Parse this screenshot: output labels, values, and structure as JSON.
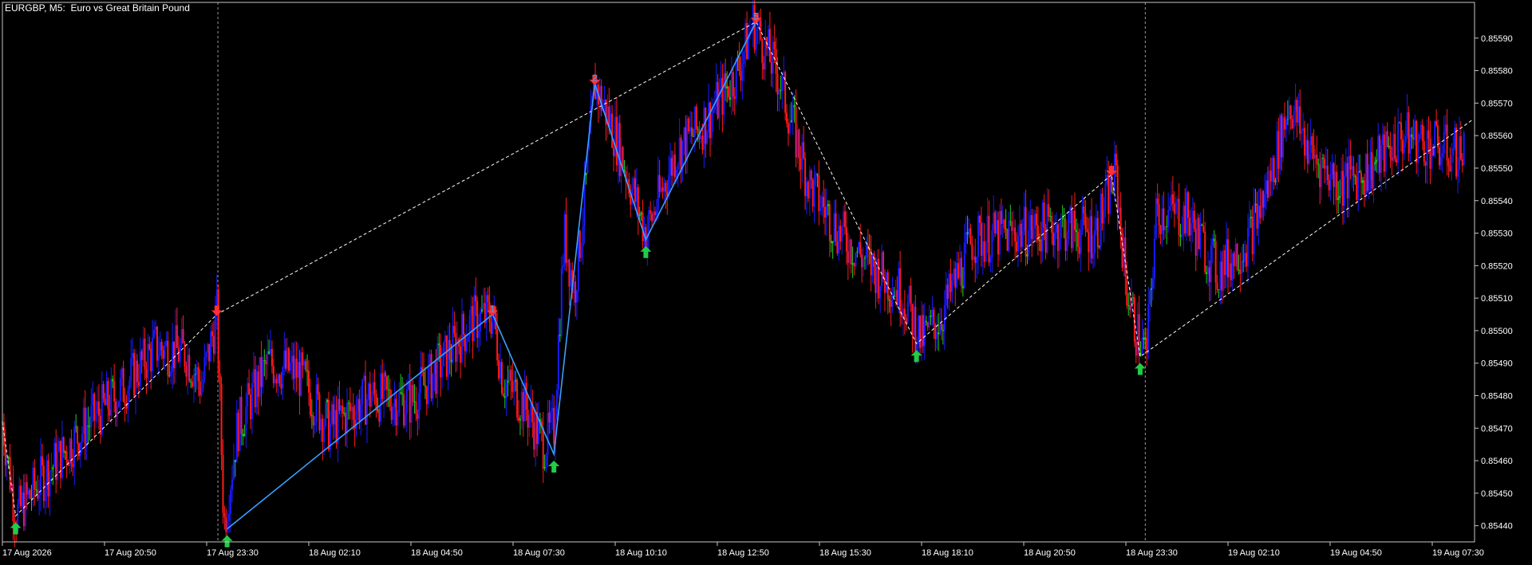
{
  "window": {
    "symbol_title": "EURGBP, M5:  Euro vs Great Britain Pound"
  },
  "colors": {
    "background": "#000000",
    "frame": "#c8c8c8",
    "text": "#ffffff",
    "bull_candle": "#1a1aff",
    "bear_candle": "#ff1a1a",
    "doji_candle": "#22cc22",
    "wave_line": "#3aa0ff",
    "dashed_zigzag": "#ffffff",
    "arrow_up": "#22cc44",
    "arrow_down": "#ff3030"
  },
  "chart_data": {
    "type": "candlestick",
    "symbol": "EURGBP",
    "timeframe": "M5",
    "ylim": [
      0.85436,
      0.856
    ],
    "price_ticks": [
      "0.85590",
      "0.85580",
      "0.85570",
      "0.85560",
      "0.85550",
      "0.85540",
      "0.85530",
      "0.85520",
      "0.85510",
      "0.85500",
      "0.85490",
      "0.85480",
      "0.85470",
      "0.85460",
      "0.85450",
      "0.85440"
    ],
    "time_ticks": [
      {
        "label": "17 Aug 2026",
        "x": 0
      },
      {
        "label": "17 Aug 20:50",
        "x": 10
      },
      {
        "label": "17 Aug 23:30",
        "x": 20
      },
      {
        "label": "18 Aug 02:10",
        "x": 30
      },
      {
        "label": "18 Aug 04:50",
        "x": 40
      },
      {
        "label": "18 Aug 07:30",
        "x": 50
      },
      {
        "label": "18 Aug 10:10",
        "x": 60
      },
      {
        "label": "18 Aug 12:50",
        "x": 70
      },
      {
        "label": "18 Aug 15:30",
        "x": 80
      },
      {
        "label": "18 Aug 18:10",
        "x": 90
      },
      {
        "label": "18 Aug 20:50",
        "x": 100
      },
      {
        "label": "18 Aug 23:30",
        "x": 110
      },
      {
        "label": "19 Aug 02:10",
        "x": 120
      },
      {
        "label": "19 Aug 04:50",
        "x": 130
      },
      {
        "label": "19 Aug 07:30",
        "x": 140
      }
    ],
    "x_range": [
      0,
      144
    ],
    "day_separators": [
      21.1,
      111.9
    ],
    "price_path": [
      {
        "x": 0,
        "p": 0.85472
      },
      {
        "x": 1.3,
        "p": 0.85443
      },
      {
        "x": 4,
        "p": 0.85455
      },
      {
        "x": 8,
        "p": 0.8547
      },
      {
        "x": 12,
        "p": 0.85483
      },
      {
        "x": 15,
        "p": 0.85495
      },
      {
        "x": 18,
        "p": 0.85493
      },
      {
        "x": 19.5,
        "p": 0.85483
      },
      {
        "x": 21,
        "p": 0.85505
      },
      {
        "x": 21.7,
        "p": 0.8544
      },
      {
        "x": 23,
        "p": 0.8547
      },
      {
        "x": 26,
        "p": 0.8549
      },
      {
        "x": 29,
        "p": 0.85487
      },
      {
        "x": 32,
        "p": 0.8547
      },
      {
        "x": 36,
        "p": 0.8548
      },
      {
        "x": 40,
        "p": 0.85478
      },
      {
        "x": 43,
        "p": 0.8549
      },
      {
        "x": 46,
        "p": 0.85503
      },
      {
        "x": 48,
        "p": 0.85505
      },
      {
        "x": 49,
        "p": 0.85485
      },
      {
        "x": 51,
        "p": 0.85478
      },
      {
        "x": 53,
        "p": 0.85465
      },
      {
        "x": 54,
        "p": 0.8547
      },
      {
        "x": 55,
        "p": 0.8553
      },
      {
        "x": 56,
        "p": 0.85512
      },
      {
        "x": 57,
        "p": 0.8554
      },
      {
        "x": 58,
        "p": 0.85576
      },
      {
        "x": 60,
        "p": 0.8556
      },
      {
        "x": 63,
        "p": 0.8553
      },
      {
        "x": 66,
        "p": 0.85555
      },
      {
        "x": 69,
        "p": 0.85565
      },
      {
        "x": 72,
        "p": 0.8558
      },
      {
        "x": 73.5,
        "p": 0.85595
      },
      {
        "x": 76,
        "p": 0.85578
      },
      {
        "x": 79,
        "p": 0.85545
      },
      {
        "x": 82,
        "p": 0.8553
      },
      {
        "x": 85,
        "p": 0.8552
      },
      {
        "x": 88,
        "p": 0.85512
      },
      {
        "x": 90,
        "p": 0.85497
      },
      {
        "x": 92,
        "p": 0.85505
      },
      {
        "x": 95,
        "p": 0.85528
      },
      {
        "x": 99,
        "p": 0.8553
      },
      {
        "x": 103,
        "p": 0.85532
      },
      {
        "x": 107,
        "p": 0.8553
      },
      {
        "x": 109,
        "p": 0.85548
      },
      {
        "x": 110,
        "p": 0.85515
      },
      {
        "x": 111,
        "p": 0.855
      },
      {
        "x": 112,
        "p": 0.85492
      },
      {
        "x": 113,
        "p": 0.85537
      },
      {
        "x": 116,
        "p": 0.85535
      },
      {
        "x": 119,
        "p": 0.85518
      },
      {
        "x": 122,
        "p": 0.85528
      },
      {
        "x": 124,
        "p": 0.85545
      },
      {
        "x": 126,
        "p": 0.8557
      },
      {
        "x": 128,
        "p": 0.85555
      },
      {
        "x": 131,
        "p": 0.85545
      },
      {
        "x": 134,
        "p": 0.8555
      },
      {
        "x": 137,
        "p": 0.8556
      },
      {
        "x": 140,
        "p": 0.85557
      },
      {
        "x": 142,
        "p": 0.85555
      }
    ],
    "wave_labels": [
      {
        "label": "1",
        "x": 48.0,
        "p": 0.85505
      },
      {
        "label": "2",
        "x": 58.0,
        "p": 0.85576
      },
      {
        "label": "5",
        "x": 73.8,
        "p": 0.85595
      }
    ],
    "wave_path": [
      {
        "x": 22.0,
        "p": 0.85439
      },
      {
        "x": 48.0,
        "p": 0.85505
      },
      {
        "x": 54.0,
        "p": 0.85462
      },
      {
        "x": 58.0,
        "p": 0.85576
      },
      {
        "x": 63.0,
        "p": 0.85528
      },
      {
        "x": 73.8,
        "p": 0.85595
      }
    ],
    "dashed_zigzag": [
      {
        "x": 0,
        "p": 0.85472
      },
      {
        "x": 1.3,
        "p": 0.85443
      },
      {
        "x": 21.0,
        "p": 0.85505
      },
      {
        "x": 73.8,
        "p": 0.85595
      },
      {
        "x": 89.5,
        "p": 0.85496
      },
      {
        "x": 108.6,
        "p": 0.85548
      },
      {
        "x": 111.4,
        "p": 0.85492
      },
      {
        "x": 144,
        "p": 0.85565
      }
    ],
    "arrows_up": [
      {
        "x": 1.3,
        "p": 0.85443
      },
      {
        "x": 22.0,
        "p": 0.85439
      },
      {
        "x": 54.0,
        "p": 0.85462
      },
      {
        "x": 63.0,
        "p": 0.85528
      },
      {
        "x": 89.5,
        "p": 0.85496
      },
      {
        "x": 111.4,
        "p": 0.85492
      }
    ],
    "arrows_down": [
      {
        "x": 21.0,
        "p": 0.85505
      },
      {
        "x": 48.0,
        "p": 0.85505
      },
      {
        "x": 58.0,
        "p": 0.85576
      },
      {
        "x": 73.8,
        "p": 0.85595
      },
      {
        "x": 108.6,
        "p": 0.85548
      }
    ]
  }
}
